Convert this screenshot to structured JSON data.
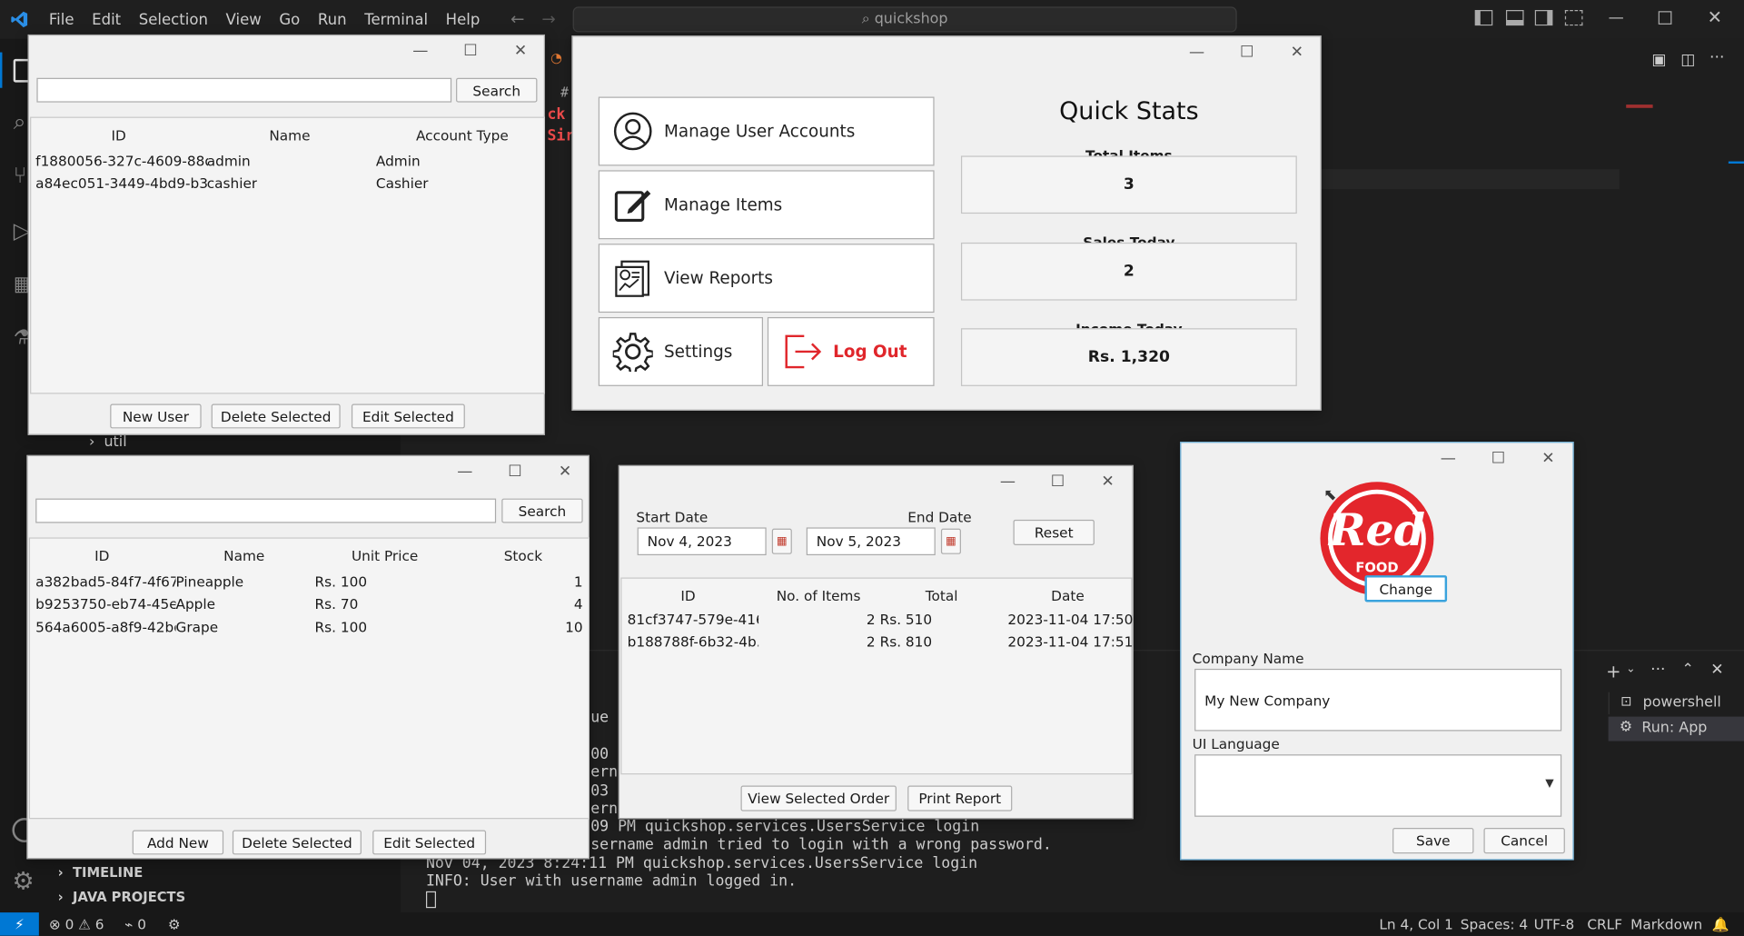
{
  "vscode": {
    "menu": [
      "File",
      "Edit",
      "Selection",
      "View",
      "Go",
      "Run",
      "Terminal",
      "Help"
    ],
    "search": "quickshop",
    "tree": {
      "util": "util",
      "timeline": "TIMELINE",
      "java_projects": "JAVA PROJECTS"
    },
    "editor_fragments": {
      "a": "#",
      "b": "ck",
      "c": "Sir"
    },
    "terminal": {
      "tabs": [
        "powershell",
        "Run: App"
      ],
      "lines": [
        "ue ",
        "00 ",
        "erna",
        "03 ",
        "erna",
        "09 PM quickshop.services.UsersService login",
        "sername admin tried to login with a wrong password.",
        "Nov 04, 2023 8:24:11 PM quickshop.services.UsersService login",
        "INFO: User with username admin logged in."
      ]
    },
    "status": {
      "errors": "0",
      "warnings": "6",
      "ports": "0",
      "position": "Ln 4, Col 1",
      "spaces": "Spaces: 4",
      "encoding": "UTF-8",
      "eol": "CRLF",
      "lang": "Markdown"
    }
  },
  "users": {
    "search_button": "Search",
    "columns": [
      "ID",
      "Name",
      "Account Type"
    ],
    "rows": [
      {
        "id": "f1880056-327c-4609-88d9...",
        "name": "admin",
        "type": "Admin"
      },
      {
        "id": "a84ec051-3449-4bd9-b32...",
        "name": "cashier",
        "type": "Cashier"
      }
    ],
    "buttons": {
      "new": "New User",
      "delete": "Delete Selected",
      "edit": "Edit Selected"
    }
  },
  "dashboard": {
    "buttons": {
      "users": "Manage User Accounts",
      "items": "Manage Items",
      "reports": "View Reports",
      "settings": "Settings",
      "logout": "Log Out"
    },
    "stats_title": "Quick Stats",
    "stats": [
      {
        "label": "Total Items",
        "value": "3"
      },
      {
        "label": "Sales Today",
        "value": "2"
      },
      {
        "label": "Income Today",
        "value": "Rs. 1,320"
      }
    ]
  },
  "items": {
    "search_button": "Search",
    "columns": [
      "ID",
      "Name",
      "Unit Price",
      "Stock"
    ],
    "rows": [
      {
        "id": "a382bad5-84f7-4f67-...",
        "name": "Pineapple",
        "price": "Rs. 100",
        "stock": "1"
      },
      {
        "id": "b9253750-eb74-45e3...",
        "name": "Apple",
        "price": "Rs. 70",
        "stock": "4"
      },
      {
        "id": "564a6005-a8f9-42bd...",
        "name": "Grape",
        "price": "Rs. 100",
        "stock": "10"
      }
    ],
    "buttons": {
      "add": "Add New",
      "delete": "Delete Selected",
      "edit": "Edit Selected"
    }
  },
  "reports": {
    "start_label": "Start Date",
    "start_value": "Nov 4, 2023",
    "end_label": "End Date",
    "end_value": "Nov 5, 2023",
    "reset": "Reset",
    "columns": [
      "ID",
      "No. of Items",
      "Total",
      "Date"
    ],
    "rows": [
      {
        "id": "81cf3747-579e-416...",
        "count": "2",
        "total": "Rs. 510",
        "date": "2023-11-04 17:50:4..."
      },
      {
        "id": "b188788f-6b32-4b...",
        "count": "2",
        "total": "Rs. 810",
        "date": "2023-11-04 17:51:0..."
      }
    ],
    "buttons": {
      "view": "View Selected Order",
      "print": "Print Report"
    }
  },
  "settings": {
    "logo_text": "Red",
    "logo_sub": "FOOD",
    "change": "Change",
    "company_label": "Company Name",
    "company_value": "My New Company",
    "language_label": "UI Language",
    "language_value": "",
    "save": "Save",
    "cancel": "Cancel"
  },
  "colors": {
    "logout": "#e0262b",
    "accent": "#0078d4",
    "logo": "#e3262c"
  }
}
